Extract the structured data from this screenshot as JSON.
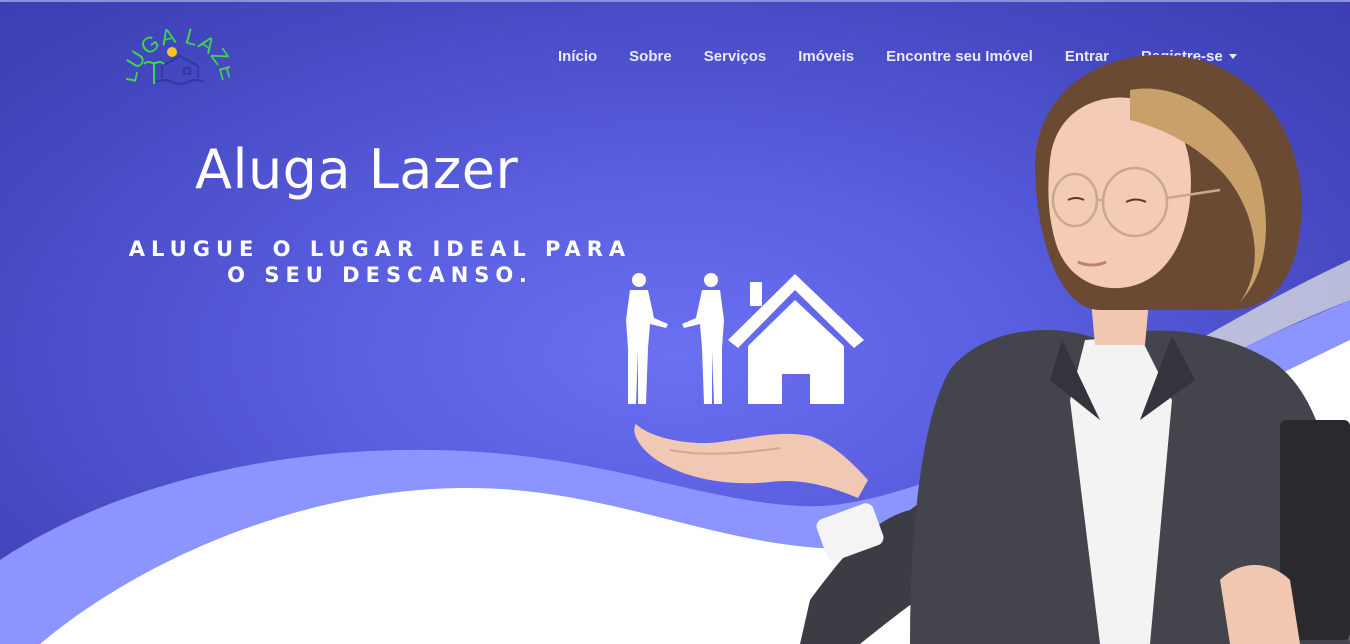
{
  "brand": {
    "logo_text": "ALUGA LAZER",
    "colors": {
      "logo_green": "#3dd64f",
      "hero_blue": "#5a5fe0",
      "wave_light": "#8c95ff"
    }
  },
  "nav": {
    "items": [
      {
        "label": "Início"
      },
      {
        "label": "Sobre"
      },
      {
        "label": "Serviços"
      },
      {
        "label": "Imóveis"
      },
      {
        "label": "Encontre seu Imóvel"
      },
      {
        "label": "Entrar"
      },
      {
        "label": "Registre-se",
        "icon": "caret-down-icon"
      }
    ]
  },
  "hero": {
    "title": "Aluga Lazer",
    "subtitle_line1": "ALUGUE O LUGAR IDEAL PARA",
    "subtitle_line2": "O SEU DESCANSO."
  },
  "illustration": {
    "icons": [
      "handshake-icon",
      "house-icon",
      "open-hand-icon"
    ]
  }
}
